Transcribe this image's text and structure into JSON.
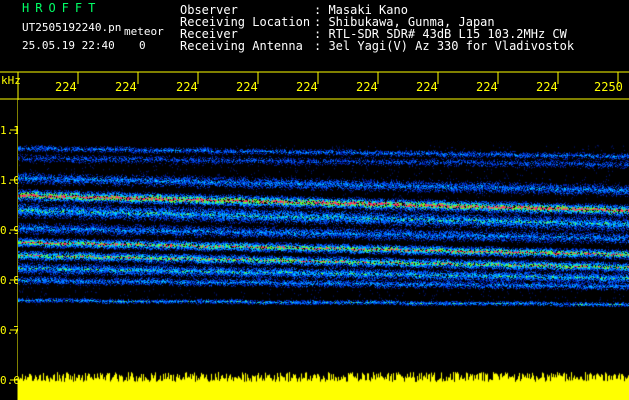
{
  "header": {
    "station": "HROFFT",
    "filename": "UT2505192240.pn",
    "mode": "meteor",
    "datetime": "25.05.19 22:40",
    "count": "0",
    "observer_label": "Observer",
    "observer_value": ": Masaki Kano",
    "location_label": "Receiving Location",
    "location_value": ": Shibukawa, Gunma, Japan",
    "receiver_label": "Receiver",
    "receiver_value": ": RTL-SDR SDR# 43dB L15 103.2MHz CW",
    "antenna_label": "Receiving Antenna",
    "antenna_value": ": 3el Yagi(V) Az 330 for Vladivostok"
  },
  "axis": {
    "y_unit": "kHz",
    "x_ticks": [
      "224",
      "224",
      "224",
      "224",
      "224",
      "224",
      "224",
      "224",
      "224",
      "2250"
    ],
    "y_ticks": [
      "1.1",
      "1.0",
      "0.9",
      "0.8",
      "0.7",
      "0.6"
    ]
  },
  "colors": {
    "background": "#000000",
    "axis": "#ffff00",
    "text": "#ffffff",
    "title": "#00ff66"
  }
}
